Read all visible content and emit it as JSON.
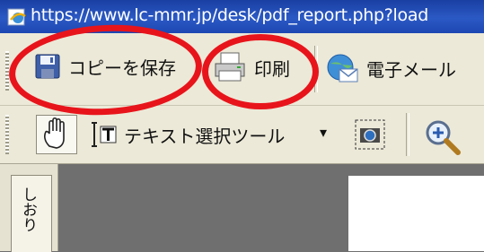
{
  "window": {
    "title": "https://www.lc-mmr.jp/desk/pdf_report.php?load"
  },
  "toolbar1": {
    "save_label": "コピーを保存",
    "print_label": "印刷",
    "email_label": "電子メール"
  },
  "toolbar2": {
    "text_select_label": "テキスト選択ツール",
    "dropdown_arrow": "▾"
  },
  "sidebar": {
    "bookmark_tab_label": "しおり"
  },
  "colors": {
    "annotation_red": "#e8141b",
    "titlebar_blue": "#2b59c4",
    "toolbar_bg": "#ece9d8",
    "workspace_gray": "#6f6f6f"
  },
  "icons": {
    "title": "browser-page-icon",
    "save": "floppy-disk-icon",
    "print": "printer-icon",
    "email": "email-globe-icon",
    "hand": "hand-tool-icon",
    "text_select": "text-select-icon",
    "snapshot": "snapshot-camera-icon",
    "zoom_in": "zoom-in-icon"
  }
}
